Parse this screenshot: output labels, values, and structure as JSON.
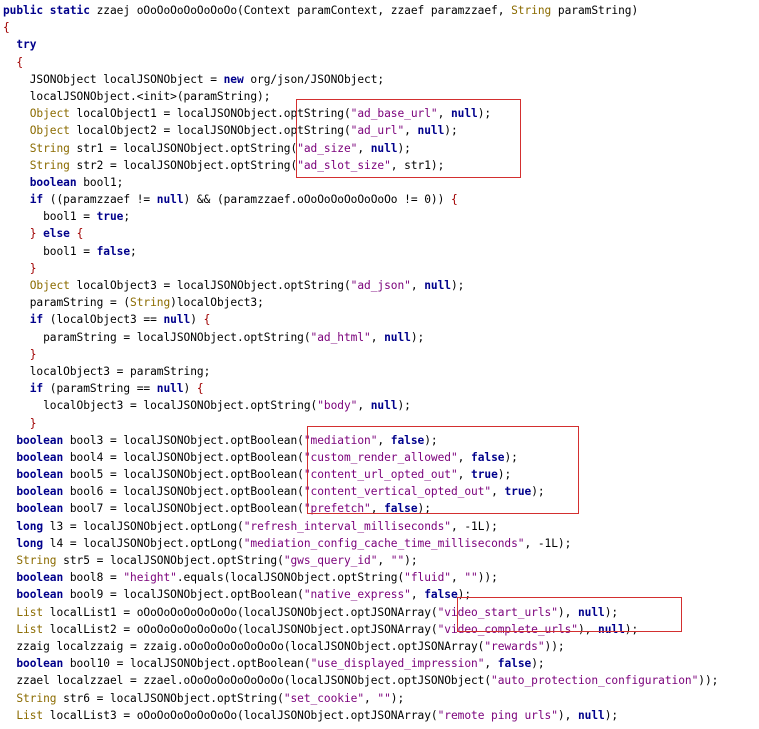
{
  "highlight_color": "#d32f2f",
  "code_lines": [
    [
      {
        "c": "k",
        "t": "public static "
      },
      {
        "t": "zzaej oOoOoOoOoOoOoOo(Context paramContext, zzaef paramzzaef, "
      },
      {
        "c": "t",
        "t": "String"
      },
      {
        "t": " paramString)"
      }
    ],
    [
      {
        "c": "p",
        "t": "{"
      }
    ],
    [
      {
        "t": "  "
      },
      {
        "c": "k",
        "t": "try"
      }
    ],
    [
      {
        "t": "  "
      },
      {
        "c": "p",
        "t": "{"
      }
    ],
    [
      {
        "t": "    JSONObject localJSONObject = "
      },
      {
        "c": "k",
        "t": "new"
      },
      {
        "t": " org/json/JSONObject;"
      }
    ],
    [
      {
        "t": "    localJSONObject.<init>(paramString);"
      }
    ],
    [
      {
        "t": "    "
      },
      {
        "c": "t",
        "t": "Object"
      },
      {
        "t": " localObject1 = localJSONObject.optString("
      },
      {
        "c": "s",
        "t": "\"ad_base_url\""
      },
      {
        "t": ", "
      },
      {
        "c": "n",
        "t": "null"
      },
      {
        "t": ");"
      }
    ],
    [
      {
        "t": "    "
      },
      {
        "c": "t",
        "t": "Object"
      },
      {
        "t": " localObject2 = localJSONObject.optString("
      },
      {
        "c": "s",
        "t": "\"ad_url\""
      },
      {
        "t": ", "
      },
      {
        "c": "n",
        "t": "null"
      },
      {
        "t": ");"
      }
    ],
    [
      {
        "t": "    "
      },
      {
        "c": "t",
        "t": "String"
      },
      {
        "t": " str1 = localJSONObject.optString("
      },
      {
        "c": "s",
        "t": "\"ad_size\""
      },
      {
        "t": ", "
      },
      {
        "c": "n",
        "t": "null"
      },
      {
        "t": ");"
      }
    ],
    [
      {
        "t": "    "
      },
      {
        "c": "t",
        "t": "String"
      },
      {
        "t": " str2 = localJSONObject.optString("
      },
      {
        "c": "s",
        "t": "\"ad_slot_size\""
      },
      {
        "t": ", str1);"
      }
    ],
    [
      {
        "t": "    "
      },
      {
        "c": "k",
        "t": "boolean"
      },
      {
        "t": " bool1;"
      }
    ],
    [
      {
        "t": "    "
      },
      {
        "c": "k",
        "t": "if"
      },
      {
        "t": " ((paramzzaef != "
      },
      {
        "c": "n",
        "t": "null"
      },
      {
        "t": ") && (paramzzaef.oOoOoOoOoOoOoOo != 0)) "
      },
      {
        "c": "p",
        "t": "{"
      }
    ],
    [
      {
        "t": "      bool1 = "
      },
      {
        "c": "n",
        "t": "true"
      },
      {
        "t": ";"
      }
    ],
    [
      {
        "t": "    "
      },
      {
        "c": "p",
        "t": "}"
      },
      {
        "t": " "
      },
      {
        "c": "k",
        "t": "else"
      },
      {
        "t": " "
      },
      {
        "c": "p",
        "t": "{"
      }
    ],
    [
      {
        "t": "      bool1 = "
      },
      {
        "c": "n",
        "t": "false"
      },
      {
        "t": ";"
      }
    ],
    [
      {
        "t": "    "
      },
      {
        "c": "p",
        "t": "}"
      }
    ],
    [
      {
        "t": "    "
      },
      {
        "c": "t",
        "t": "Object"
      },
      {
        "t": " localObject3 = localJSONObject.optString("
      },
      {
        "c": "s",
        "t": "\"ad_json\""
      },
      {
        "t": ", "
      },
      {
        "c": "n",
        "t": "null"
      },
      {
        "t": ");"
      }
    ],
    [
      {
        "t": "    paramString = ("
      },
      {
        "c": "t",
        "t": "String"
      },
      {
        "t": ")localObject3;"
      }
    ],
    [
      {
        "t": "    "
      },
      {
        "c": "k",
        "t": "if"
      },
      {
        "t": " (localObject3 == "
      },
      {
        "c": "n",
        "t": "null"
      },
      {
        "t": ") "
      },
      {
        "c": "p",
        "t": "{"
      }
    ],
    [
      {
        "t": "      paramString = localJSONObject.optString("
      },
      {
        "c": "s",
        "t": "\"ad_html\""
      },
      {
        "t": ", "
      },
      {
        "c": "n",
        "t": "null"
      },
      {
        "t": ");"
      }
    ],
    [
      {
        "t": "    "
      },
      {
        "c": "p",
        "t": "}"
      }
    ],
    [
      {
        "t": "    localObject3 = paramString;"
      }
    ],
    [
      {
        "t": "    "
      },
      {
        "c": "k",
        "t": "if"
      },
      {
        "t": " (paramString == "
      },
      {
        "c": "n",
        "t": "null"
      },
      {
        "t": ") "
      },
      {
        "c": "p",
        "t": "{"
      }
    ],
    [
      {
        "t": "      localObject3 = localJSONObject.optString("
      },
      {
        "c": "s",
        "t": "\"body\""
      },
      {
        "t": ", "
      },
      {
        "c": "n",
        "t": "null"
      },
      {
        "t": ");"
      }
    ],
    [
      {
        "t": "    "
      },
      {
        "c": "p",
        "t": "}"
      }
    ],
    [
      {
        "t": "  "
      },
      {
        "c": "k",
        "t": "boolean"
      },
      {
        "t": " bool3 = localJSONObject.optBoolean("
      },
      {
        "c": "s",
        "t": "\"mediation\""
      },
      {
        "t": ", "
      },
      {
        "c": "n",
        "t": "false"
      },
      {
        "t": ");"
      }
    ],
    [
      {
        "t": "  "
      },
      {
        "c": "k",
        "t": "boolean"
      },
      {
        "t": " bool4 = localJSONObject.optBoolean("
      },
      {
        "c": "s",
        "t": "\"custom_render_allowed\""
      },
      {
        "t": ", "
      },
      {
        "c": "n",
        "t": "false"
      },
      {
        "t": ");"
      }
    ],
    [
      {
        "t": "  "
      },
      {
        "c": "k",
        "t": "boolean"
      },
      {
        "t": " bool5 = localJSONObject.optBoolean("
      },
      {
        "c": "s",
        "t": "\"content_url_opted_out\""
      },
      {
        "t": ", "
      },
      {
        "c": "n",
        "t": "true"
      },
      {
        "t": ");"
      }
    ],
    [
      {
        "t": "  "
      },
      {
        "c": "k",
        "t": "boolean"
      },
      {
        "t": " bool6 = localJSONObject.optBoolean("
      },
      {
        "c": "s",
        "t": "\"content_vertical_opted_out\""
      },
      {
        "t": ", "
      },
      {
        "c": "n",
        "t": "true"
      },
      {
        "t": ");"
      }
    ],
    [
      {
        "t": "  "
      },
      {
        "c": "k",
        "t": "boolean"
      },
      {
        "t": " bool7 = localJSONObject.optBoolean("
      },
      {
        "c": "s",
        "t": "\"prefetch\""
      },
      {
        "t": ", "
      },
      {
        "c": "n",
        "t": "false"
      },
      {
        "t": ");"
      }
    ],
    [
      {
        "t": "  "
      },
      {
        "c": "k",
        "t": "long"
      },
      {
        "t": " l3 = localJSONObject.optLong("
      },
      {
        "c": "s",
        "t": "\"refresh_interval_milliseconds\""
      },
      {
        "t": ", -1L);"
      }
    ],
    [
      {
        "t": "  "
      },
      {
        "c": "k",
        "t": "long"
      },
      {
        "t": " l4 = localJSONObject.optLong("
      },
      {
        "c": "s",
        "t": "\"mediation_config_cache_time_milliseconds\""
      },
      {
        "t": ", -1L);"
      }
    ],
    [
      {
        "t": "  "
      },
      {
        "c": "t",
        "t": "String"
      },
      {
        "t": " str5 = localJSONObject.optString("
      },
      {
        "c": "s",
        "t": "\"gws_query_id\""
      },
      {
        "t": ", "
      },
      {
        "c": "s",
        "t": "\"\""
      },
      {
        "t": ");"
      }
    ],
    [
      {
        "t": "  "
      },
      {
        "c": "k",
        "t": "boolean"
      },
      {
        "t": " bool8 = "
      },
      {
        "c": "s",
        "t": "\"height\""
      },
      {
        "t": ".equals(localJSONObject.optString("
      },
      {
        "c": "s",
        "t": "\"fluid\""
      },
      {
        "t": ", "
      },
      {
        "c": "s",
        "t": "\"\""
      },
      {
        "t": "));"
      }
    ],
    [
      {
        "t": "  "
      },
      {
        "c": "k",
        "t": "boolean"
      },
      {
        "t": " bool9 = localJSONObject.optBoolean("
      },
      {
        "c": "s",
        "t": "\"native_express\""
      },
      {
        "t": ", "
      },
      {
        "c": "n",
        "t": "false"
      },
      {
        "t": ");"
      }
    ],
    [
      {
        "t": "  "
      },
      {
        "c": "t",
        "t": "List"
      },
      {
        "t": " localList1 = oOoOoOoOoOoOoOo(localJSONObject.optJSONArray("
      },
      {
        "c": "s",
        "t": "\"video_start_urls\""
      },
      {
        "t": "), "
      },
      {
        "c": "n",
        "t": "null"
      },
      {
        "t": ");"
      }
    ],
    [
      {
        "t": "  "
      },
      {
        "c": "t",
        "t": "List"
      },
      {
        "t": " localList2 = oOoOoOoOoOoOoOo(localJSONObject.optJSONArray("
      },
      {
        "c": "s",
        "t": "\"video_complete_urls\""
      },
      {
        "t": "), "
      },
      {
        "c": "n",
        "t": "null"
      },
      {
        "t": ");"
      }
    ],
    [
      {
        "t": "  zzaig localzzaig = zzaig.oOoOoOoOoOoOoOo(localJSONObject.optJSONArray("
      },
      {
        "c": "s",
        "t": "\"rewards\""
      },
      {
        "t": "));"
      }
    ],
    [
      {
        "t": "  "
      },
      {
        "c": "k",
        "t": "boolean"
      },
      {
        "t": " bool10 = localJSONObject.optBoolean("
      },
      {
        "c": "s",
        "t": "\"use_displayed_impression\""
      },
      {
        "t": ", "
      },
      {
        "c": "n",
        "t": "false"
      },
      {
        "t": ");"
      }
    ],
    [
      {
        "t": "  zzael localzzael = zzael.oOoOoOoOoOoOoOo(localJSONObject.optJSONObject("
      },
      {
        "c": "s",
        "t": "\"auto_protection_configuration\""
      },
      {
        "t": "));"
      }
    ],
    [
      {
        "t": "  "
      },
      {
        "c": "t",
        "t": "String"
      },
      {
        "t": " str6 = localJSONObject.optString("
      },
      {
        "c": "s",
        "t": "\"set_cookie\""
      },
      {
        "t": ", "
      },
      {
        "c": "s",
        "t": "\"\""
      },
      {
        "t": ");"
      }
    ],
    [
      {
        "t": "  "
      },
      {
        "c": "t",
        "t": "List"
      },
      {
        "t": " localList3 = oOoOoOoOoOoOoOo(localJSONObject.optJSONArray("
      },
      {
        "c": "s",
        "t": "\"remote ping urls\""
      },
      {
        "t": "), "
      },
      {
        "c": "n",
        "t": "null"
      },
      {
        "t": ");"
      }
    ]
  ]
}
